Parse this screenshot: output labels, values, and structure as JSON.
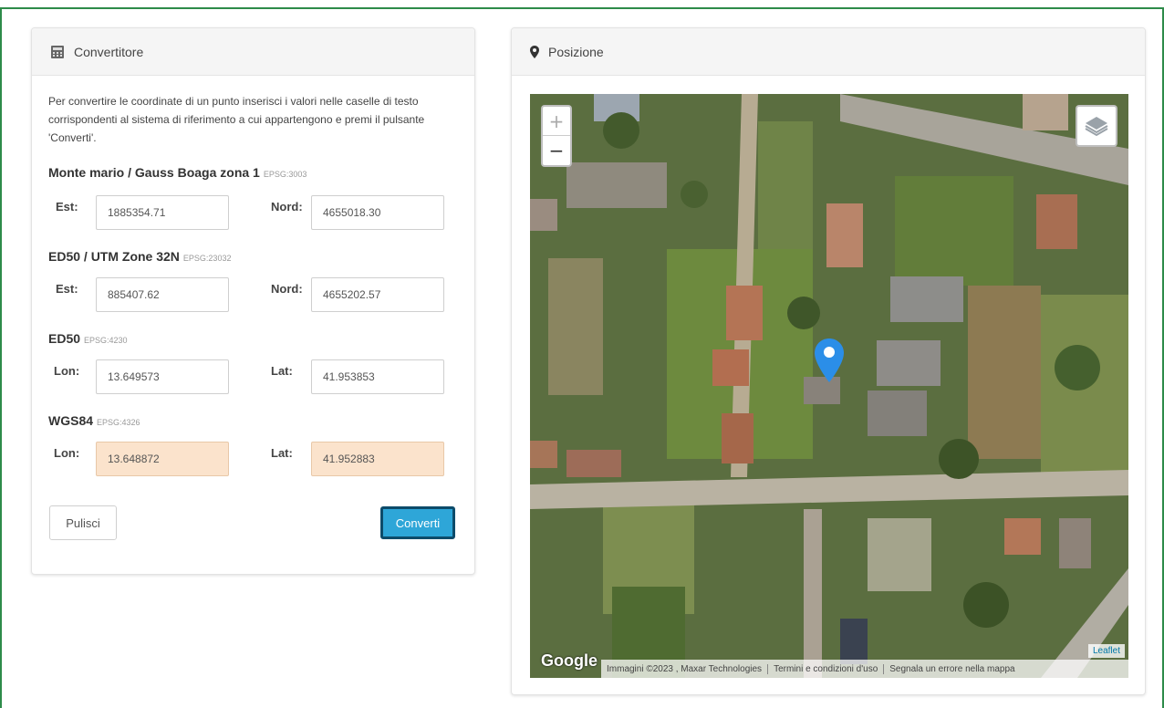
{
  "converter": {
    "title": "Convertitore",
    "intro": "Per convertire le coordinate di un punto inserisci i valori nelle caselle di testo corrispondenti al sistema di riferimento a cui appartengono e premi il pulsante 'Converti'.",
    "systems": [
      {
        "name": "Monte mario / Gauss Boaga zona 1",
        "epsg": "EPSG:3003",
        "label1": "Est:",
        "value1": "1885354.71",
        "label2": "Nord:",
        "value2": "4655018.30"
      },
      {
        "name": "ED50 / UTM Zone 32N",
        "epsg": "EPSG:23032",
        "label1": "Est:",
        "value1": "885407.62",
        "label2": "Nord:",
        "value2": "4655202.57"
      },
      {
        "name": "ED50",
        "epsg": "EPSG:4230",
        "label1": "Lon:",
        "value1": "13.649573",
        "label2": "Lat:",
        "value2": "41.953853"
      },
      {
        "name": "WGS84",
        "epsg": "EPSG:4326",
        "label1": "Lon:",
        "value1": "13.648872",
        "label2": "Lat:",
        "value2": "41.952883"
      }
    ],
    "clear_label": "Pulisci",
    "convert_label": "Converti",
    "result_color": "#fbe3cc",
    "convert_color": "#2ea6d8"
  },
  "position": {
    "title": "Posizione",
    "zoom_in": "+",
    "zoom_out": "−",
    "google_logo": "Google",
    "attribution": [
      "Immagini ©2023 , Maxar Technologies",
      "Termini e condizioni d'uso",
      "Segnala un errore nella mappa"
    ],
    "leaflet_link": "Leaflet",
    "marker_color": "#2b8ee8"
  }
}
